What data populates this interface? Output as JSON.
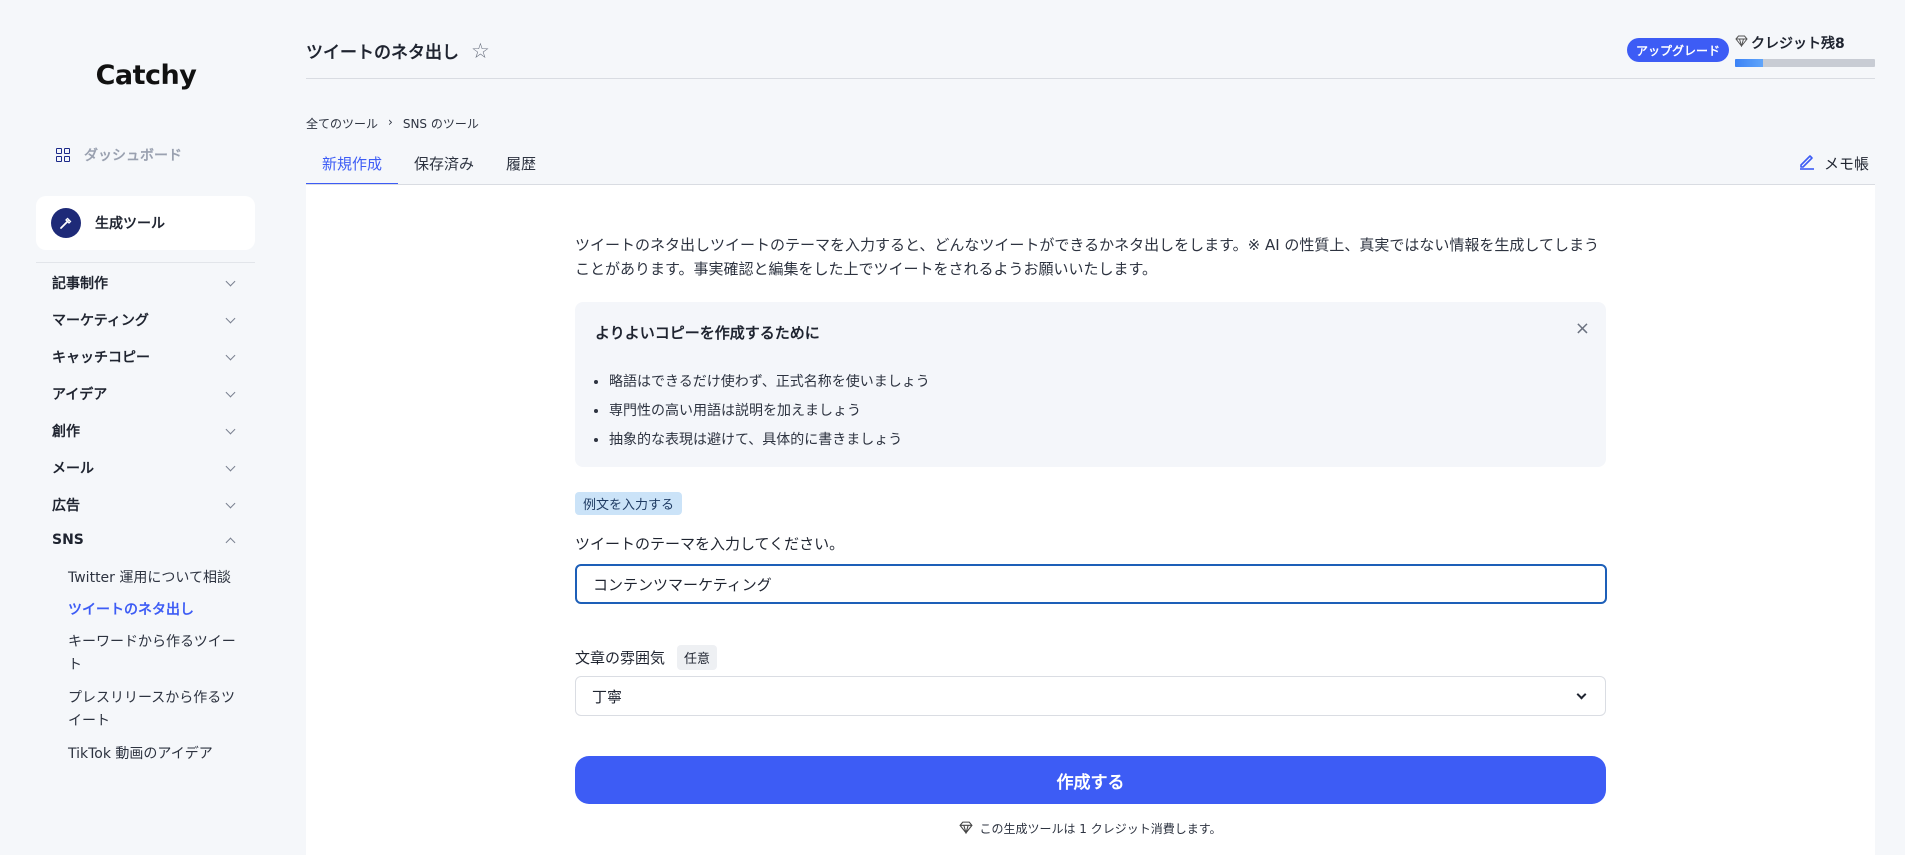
{
  "sidebar": {
    "logo": "Catchy",
    "dashboard": "ダッシュボード",
    "generate_tools": "生成ツール",
    "categories": [
      {
        "label": "記事制作"
      },
      {
        "label": "マーケティング"
      },
      {
        "label": "キャッチコピー"
      },
      {
        "label": "アイデア"
      },
      {
        "label": "創作"
      },
      {
        "label": "メール"
      },
      {
        "label": "広告"
      },
      {
        "label": "SNS"
      }
    ],
    "sns_items": [
      "Twitter 運用について相談",
      "ツイートのネタ出し",
      "キーワードから作るツイート",
      "プレスリリースから作るツイート",
      "TikTok 動画のアイデア"
    ]
  },
  "header": {
    "title": "ツイートのネタ出し",
    "upgrade": "アップグレード",
    "credit": "クレジット残8",
    "credit_fill_fraction": 0.2
  },
  "breadcrumb": [
    "全てのツール",
    "SNS のツール"
  ],
  "breadcrumb_sep": "›",
  "tabs": [
    "新規作成",
    "保存済み",
    "履歴"
  ],
  "memo": "メモ帳",
  "main": {
    "description": "ツイートのネタ出しツイートのテーマを入力すると、どんなツイートができるかネタ出しをします。※ AI の性質上、真実ではない情報を生成してしまうことがあります。事実確認と編集をした上でツイートをされるようお願いいたします。",
    "tips_title": "よりよいコピーを作成するために",
    "tips_close": "×",
    "tips": [
      "略語はできるだけ使わず、正式名称を使いましょう",
      "専門性の高い用語は説明を加えましょう",
      "抽象的な表現は避けて、具体的に書きましょう"
    ],
    "example_button": "例文を入力する",
    "theme_label": "ツイートのテーマを入力してください。",
    "theme_value": "コンテンツマーケティング",
    "tone_label": "文章の雰囲気",
    "optional": "任意",
    "tone_value": "丁寧",
    "create_button": "作成する",
    "credit_note": "この生成ツールは 1 クレジット消費します。"
  }
}
